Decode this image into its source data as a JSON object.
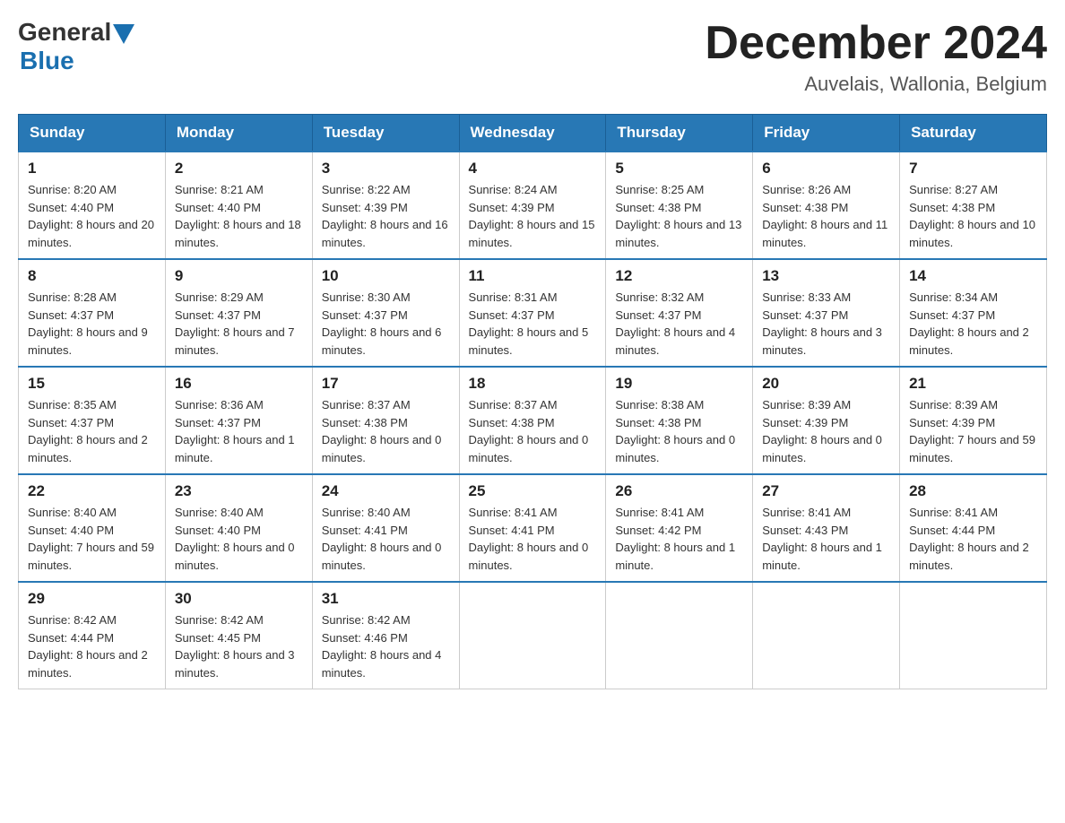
{
  "header": {
    "logo_general": "General",
    "logo_blue": "Blue",
    "month_title": "December 2024",
    "location": "Auvelais, Wallonia, Belgium"
  },
  "weekdays": [
    "Sunday",
    "Monday",
    "Tuesday",
    "Wednesday",
    "Thursday",
    "Friday",
    "Saturday"
  ],
  "weeks": [
    [
      {
        "day": "1",
        "sunrise": "8:20 AM",
        "sunset": "4:40 PM",
        "daylight": "8 hours and 20 minutes."
      },
      {
        "day": "2",
        "sunrise": "8:21 AM",
        "sunset": "4:40 PM",
        "daylight": "8 hours and 18 minutes."
      },
      {
        "day": "3",
        "sunrise": "8:22 AM",
        "sunset": "4:39 PM",
        "daylight": "8 hours and 16 minutes."
      },
      {
        "day": "4",
        "sunrise": "8:24 AM",
        "sunset": "4:39 PM",
        "daylight": "8 hours and 15 minutes."
      },
      {
        "day": "5",
        "sunrise": "8:25 AM",
        "sunset": "4:38 PM",
        "daylight": "8 hours and 13 minutes."
      },
      {
        "day": "6",
        "sunrise": "8:26 AM",
        "sunset": "4:38 PM",
        "daylight": "8 hours and 11 minutes."
      },
      {
        "day": "7",
        "sunrise": "8:27 AM",
        "sunset": "4:38 PM",
        "daylight": "8 hours and 10 minutes."
      }
    ],
    [
      {
        "day": "8",
        "sunrise": "8:28 AM",
        "sunset": "4:37 PM",
        "daylight": "8 hours and 9 minutes."
      },
      {
        "day": "9",
        "sunrise": "8:29 AM",
        "sunset": "4:37 PM",
        "daylight": "8 hours and 7 minutes."
      },
      {
        "day": "10",
        "sunrise": "8:30 AM",
        "sunset": "4:37 PM",
        "daylight": "8 hours and 6 minutes."
      },
      {
        "day": "11",
        "sunrise": "8:31 AM",
        "sunset": "4:37 PM",
        "daylight": "8 hours and 5 minutes."
      },
      {
        "day": "12",
        "sunrise": "8:32 AM",
        "sunset": "4:37 PM",
        "daylight": "8 hours and 4 minutes."
      },
      {
        "day": "13",
        "sunrise": "8:33 AM",
        "sunset": "4:37 PM",
        "daylight": "8 hours and 3 minutes."
      },
      {
        "day": "14",
        "sunrise": "8:34 AM",
        "sunset": "4:37 PM",
        "daylight": "8 hours and 2 minutes."
      }
    ],
    [
      {
        "day": "15",
        "sunrise": "8:35 AM",
        "sunset": "4:37 PM",
        "daylight": "8 hours and 2 minutes."
      },
      {
        "day": "16",
        "sunrise": "8:36 AM",
        "sunset": "4:37 PM",
        "daylight": "8 hours and 1 minute."
      },
      {
        "day": "17",
        "sunrise": "8:37 AM",
        "sunset": "4:38 PM",
        "daylight": "8 hours and 0 minutes."
      },
      {
        "day": "18",
        "sunrise": "8:37 AM",
        "sunset": "4:38 PM",
        "daylight": "8 hours and 0 minutes."
      },
      {
        "day": "19",
        "sunrise": "8:38 AM",
        "sunset": "4:38 PM",
        "daylight": "8 hours and 0 minutes."
      },
      {
        "day": "20",
        "sunrise": "8:39 AM",
        "sunset": "4:39 PM",
        "daylight": "8 hours and 0 minutes."
      },
      {
        "day": "21",
        "sunrise": "8:39 AM",
        "sunset": "4:39 PM",
        "daylight": "7 hours and 59 minutes."
      }
    ],
    [
      {
        "day": "22",
        "sunrise": "8:40 AM",
        "sunset": "4:40 PM",
        "daylight": "7 hours and 59 minutes."
      },
      {
        "day": "23",
        "sunrise": "8:40 AM",
        "sunset": "4:40 PM",
        "daylight": "8 hours and 0 minutes."
      },
      {
        "day": "24",
        "sunrise": "8:40 AM",
        "sunset": "4:41 PM",
        "daylight": "8 hours and 0 minutes."
      },
      {
        "day": "25",
        "sunrise": "8:41 AM",
        "sunset": "4:41 PM",
        "daylight": "8 hours and 0 minutes."
      },
      {
        "day": "26",
        "sunrise": "8:41 AM",
        "sunset": "4:42 PM",
        "daylight": "8 hours and 1 minute."
      },
      {
        "day": "27",
        "sunrise": "8:41 AM",
        "sunset": "4:43 PM",
        "daylight": "8 hours and 1 minute."
      },
      {
        "day": "28",
        "sunrise": "8:41 AM",
        "sunset": "4:44 PM",
        "daylight": "8 hours and 2 minutes."
      }
    ],
    [
      {
        "day": "29",
        "sunrise": "8:42 AM",
        "sunset": "4:44 PM",
        "daylight": "8 hours and 2 minutes."
      },
      {
        "day": "30",
        "sunrise": "8:42 AM",
        "sunset": "4:45 PM",
        "daylight": "8 hours and 3 minutes."
      },
      {
        "day": "31",
        "sunrise": "8:42 AM",
        "sunset": "4:46 PM",
        "daylight": "8 hours and 4 minutes."
      },
      null,
      null,
      null,
      null
    ]
  ]
}
